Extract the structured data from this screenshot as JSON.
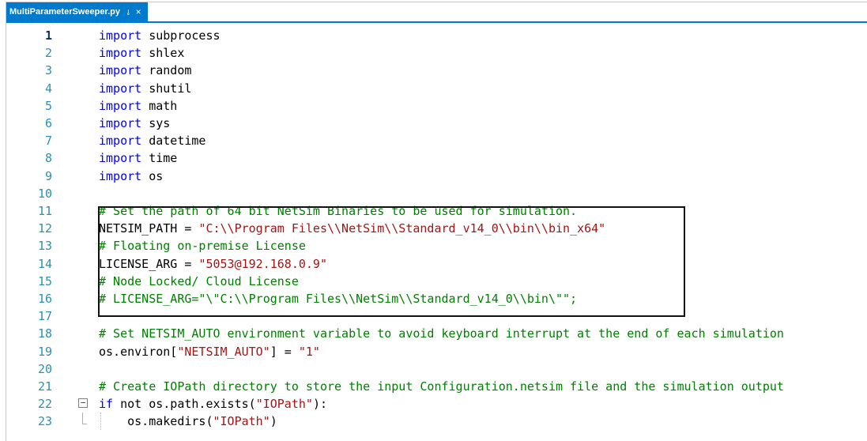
{
  "tab": {
    "title": "MultiParameterSweeper.py",
    "pin_glyph": "⊸",
    "close_glyph": "×"
  },
  "fold_glyph": "−",
  "lines": [
    {
      "num": "1",
      "current": true,
      "tokens": [
        {
          "t": "import",
          "c": "kw"
        },
        {
          "t": " subprocess",
          "c": "tx"
        }
      ]
    },
    {
      "num": "2",
      "tokens": [
        {
          "t": "import",
          "c": "kw"
        },
        {
          "t": " shlex",
          "c": "tx"
        }
      ]
    },
    {
      "num": "3",
      "tokens": [
        {
          "t": "import",
          "c": "kw"
        },
        {
          "t": " random",
          "c": "tx"
        }
      ]
    },
    {
      "num": "4",
      "tokens": [
        {
          "t": "import",
          "c": "kw"
        },
        {
          "t": " shutil",
          "c": "tx"
        }
      ]
    },
    {
      "num": "5",
      "tokens": [
        {
          "t": "import",
          "c": "kw"
        },
        {
          "t": " math",
          "c": "tx"
        }
      ]
    },
    {
      "num": "6",
      "tokens": [
        {
          "t": "import",
          "c": "kw"
        },
        {
          "t": " sys",
          "c": "tx"
        }
      ]
    },
    {
      "num": "7",
      "tokens": [
        {
          "t": "import",
          "c": "kw"
        },
        {
          "t": " datetime",
          "c": "tx"
        }
      ]
    },
    {
      "num": "8",
      "tokens": [
        {
          "t": "import",
          "c": "kw"
        },
        {
          "t": " time",
          "c": "tx"
        }
      ]
    },
    {
      "num": "9",
      "tokens": [
        {
          "t": "import",
          "c": "kw"
        },
        {
          "t": " os",
          "c": "tx"
        }
      ]
    },
    {
      "num": "10",
      "tokens": []
    },
    {
      "num": "11",
      "tokens": [
        {
          "t": "# Set the path of 64 bit NetSim Binaries to be used for simulation.",
          "c": "cm"
        }
      ]
    },
    {
      "num": "12",
      "tokens": [
        {
          "t": "NETSIM_PATH = ",
          "c": "tx"
        },
        {
          "t": "\"C:\\\\Program Files\\\\NetSim\\\\Standard_v14_0\\\\bin\\\\bin_x64\"",
          "c": "st"
        }
      ]
    },
    {
      "num": "13",
      "tokens": [
        {
          "t": "# Floating on-premise License",
          "c": "cm"
        }
      ]
    },
    {
      "num": "14",
      "tokens": [
        {
          "t": "LICENSE_ARG = ",
          "c": "tx"
        },
        {
          "t": "\"5053@192.168.0.9\"",
          "c": "st"
        }
      ]
    },
    {
      "num": "15",
      "tokens": [
        {
          "t": "# Node Locked/ Cloud License",
          "c": "cm"
        }
      ]
    },
    {
      "num": "16",
      "tokens": [
        {
          "t": "# LICENSE_ARG=\"\\\"C:\\\\Program Files\\\\NetSim\\\\Standard_v14_0\\\\bin\\\"\";",
          "c": "cm"
        }
      ]
    },
    {
      "num": "17",
      "tokens": []
    },
    {
      "num": "18",
      "tokens": [
        {
          "t": "# Set NETSIM_AUTO environment variable to avoid keyboard interrupt at the end of each simulation",
          "c": "cm"
        }
      ]
    },
    {
      "num": "19",
      "tokens": [
        {
          "t": "os.environ[",
          "c": "tx"
        },
        {
          "t": "\"NETSIM_AUTO\"",
          "c": "st"
        },
        {
          "t": "] = ",
          "c": "tx"
        },
        {
          "t": "\"1\"",
          "c": "st"
        }
      ]
    },
    {
      "num": "20",
      "tokens": []
    },
    {
      "num": "21",
      "tokens": [
        {
          "t": "# Create IOPath directory to store the input Configuration.netsim file and the simulation output",
          "c": "cm"
        }
      ]
    },
    {
      "num": "22",
      "fold": true,
      "tokens": [
        {
          "t": "if",
          "c": "kw"
        },
        {
          "t": " not os.path.exists(",
          "c": "tx"
        },
        {
          "t": "\"IOPath\"",
          "c": "st"
        },
        {
          "t": "):",
          "c": "tx"
        }
      ]
    },
    {
      "num": "23",
      "fold_end": true,
      "indent": true,
      "tokens": [
        {
          "t": "    os.makedirs(",
          "c": "tx"
        },
        {
          "t": "\"IOPath\"",
          "c": "st"
        },
        {
          "t": ")",
          "c": "tx"
        }
      ]
    }
  ]
}
